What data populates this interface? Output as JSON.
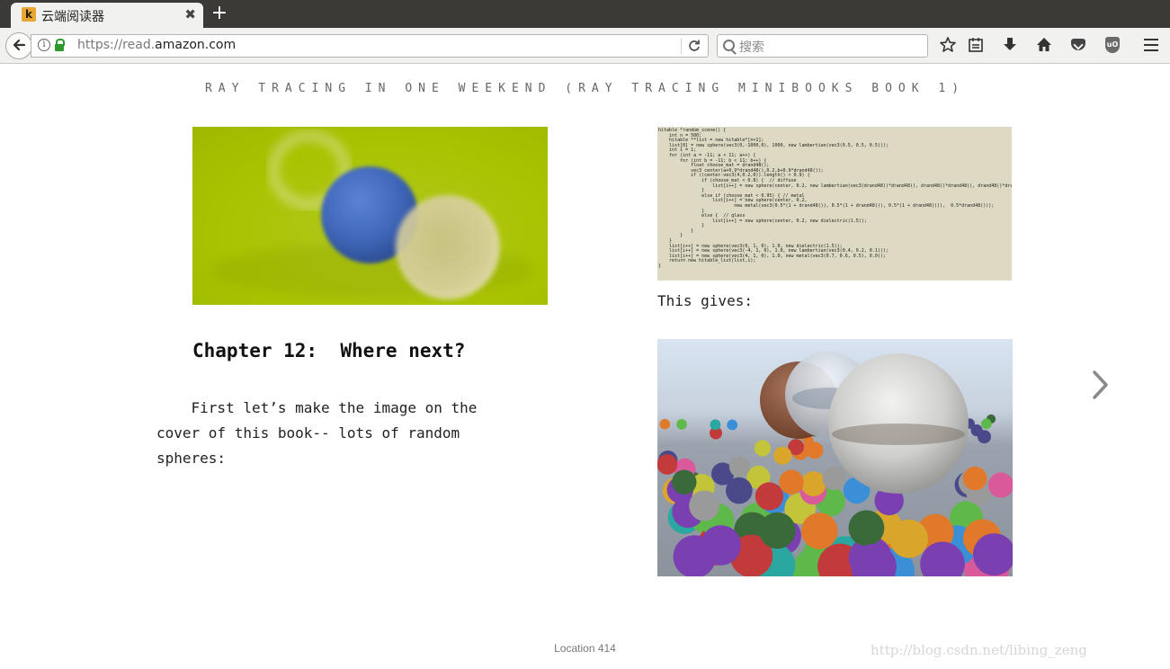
{
  "browser": {
    "tab_title": "云端阅读器",
    "tab_favicon_letter": "k",
    "tab_close": "✖",
    "new_tab": "+",
    "url_prefix": "https://read.",
    "url_domain": "amazon.com",
    "search_placeholder": "搜索",
    "icons": [
      "back-arrow-icon",
      "info-icon",
      "lock-icon",
      "reload-icon",
      "search-icon",
      "bookmark-star-icon",
      "reading-list-icon",
      "download-icon",
      "home-icon",
      "pocket-icon",
      "ublock-icon",
      "menu-icon"
    ]
  },
  "reader": {
    "book_title": "RAY TRACING IN ONE WEEKEND (RAY TRACING MINIBOOKS BOOK 1)",
    "chapter_heading": "Chapter 12:  Where next?",
    "paragraph_lines": [
      "    First let’s make the image on the",
      "cover of this book-- lots of random",
      "spheres:"
    ],
    "code_lines": [
      "hitable *random_scene() {",
      "    int n = 500;",
      "    hitable **list = new hitable*[n+1];",
      "    list[0] = new sphere(vec3(0,-1000,0), 1000, new lambertian(vec3(0.5, 0.5, 0.5)));",
      "    int i = 1;",
      "    for (int a = -11; a < 11; a++) {",
      "        for (int b = -11; b < 11; b++) {",
      "            float choose_mat = drand48();",
      "            vec3 center(a+0.9*drand48(),0.2,b+0.9*drand48());",
      "            if ((center-vec3(4,0.2,0)).length() > 0.9) {",
      "                if (choose_mat < 0.8) {  // diffuse",
      "                    list[i++] = new sphere(center, 0.2, new lambertian(vec3(drand48()*drand48(), drand48()*drand48(), drand48()*drand48())));",
      "                }",
      "                else if (choose_mat < 0.95) { // metal",
      "                    list[i++] = new sphere(center, 0.2,",
      "                            new metal(vec3(0.5*(1 + drand48()), 0.5*(1 + drand48()), 0.5*(1 + drand48())),  0.5*drand48()));",
      "                }",
      "                else {  // glass",
      "                    list[i++] = new sphere(center, 0.2, new dielectric(1.5));",
      "                }",
      "            }",
      "        }",
      "    }",
      "",
      "    list[i++] = new sphere(vec3(0, 1, 0), 1.0, new dielectric(1.5));",
      "    list[i++] = new sphere(vec3(-4, 1, 0), 1.0, new lambertian(vec3(0.4, 0.2, 0.1)));",
      "    list[i++] = new sphere(vec3(4, 1, 0), 1.0, new metal(vec3(0.7, 0.6, 0.5), 0.0));",
      "",
      "    return new hitable_list(list,i);",
      "}"
    ],
    "this_gives": "This gives:",
    "location": "Location 414",
    "next_page_icon": "chevron-right-icon"
  },
  "watermark": "http://blog.csdn.net/libing_zeng"
}
